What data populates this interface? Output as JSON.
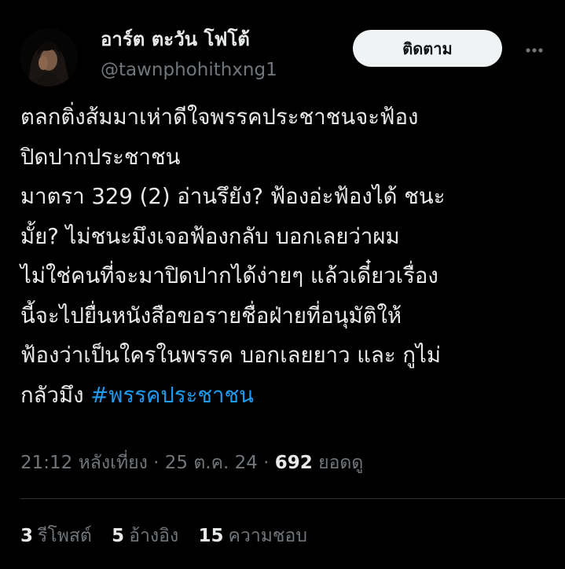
{
  "author": {
    "display_name": "อาร์ต ตะวัน โฟโต้",
    "handle": "@tawnphohithxng1"
  },
  "header": {
    "follow_label": "ติดตาม",
    "more_icon": "more-horizontal-icon"
  },
  "tweet": {
    "lines": [
      "ตลกติ่งส้มมาเห่าดีใจพรรคประชาชนจะฟ้อง",
      "ปิดปากประชาชน",
      "มาตรา 329 (2) อ่านรึยัง? ฟ้องอ่ะฟ้องได้ ชนะ",
      "มั้ย? ไม่ชนะมึงเจอฟ้องกลับ บอกเลยว่าผม",
      "ไม่ใช่คนที่จะมาปิดปากได้ง่ายๆ แล้วเดี๋ยวเรื่อง",
      "นี้จะไปยื่นหนังสือขอรายชื่อฝ่ายที่อนุมัติให้",
      "ฟ้องว่าเป็นใครในพรรค บอกเลยยาว และ กูไม่"
    ],
    "last_line_prefix": "กลัวมึง ",
    "hashtag": "#พรรคประชาชน"
  },
  "meta": {
    "time": "21:12 หลังเที่ยง",
    "separator": " · ",
    "date": "25 ต.ค. 24",
    "views_count": "692",
    "views_label": " ยอดดู"
  },
  "stats": {
    "reposts_count": "3",
    "reposts_label": "รีโพสต์",
    "quotes_count": "5",
    "quotes_label": "อ้างอิง",
    "likes_count": "15",
    "likes_label": "ความชอบ"
  },
  "colors": {
    "background": "#000000",
    "text": "#e7e9ea",
    "secondary_text": "#71767b",
    "accent": "#1d9bf0",
    "follow_button_bg": "#eff3f4",
    "divider": "#2f3336"
  }
}
